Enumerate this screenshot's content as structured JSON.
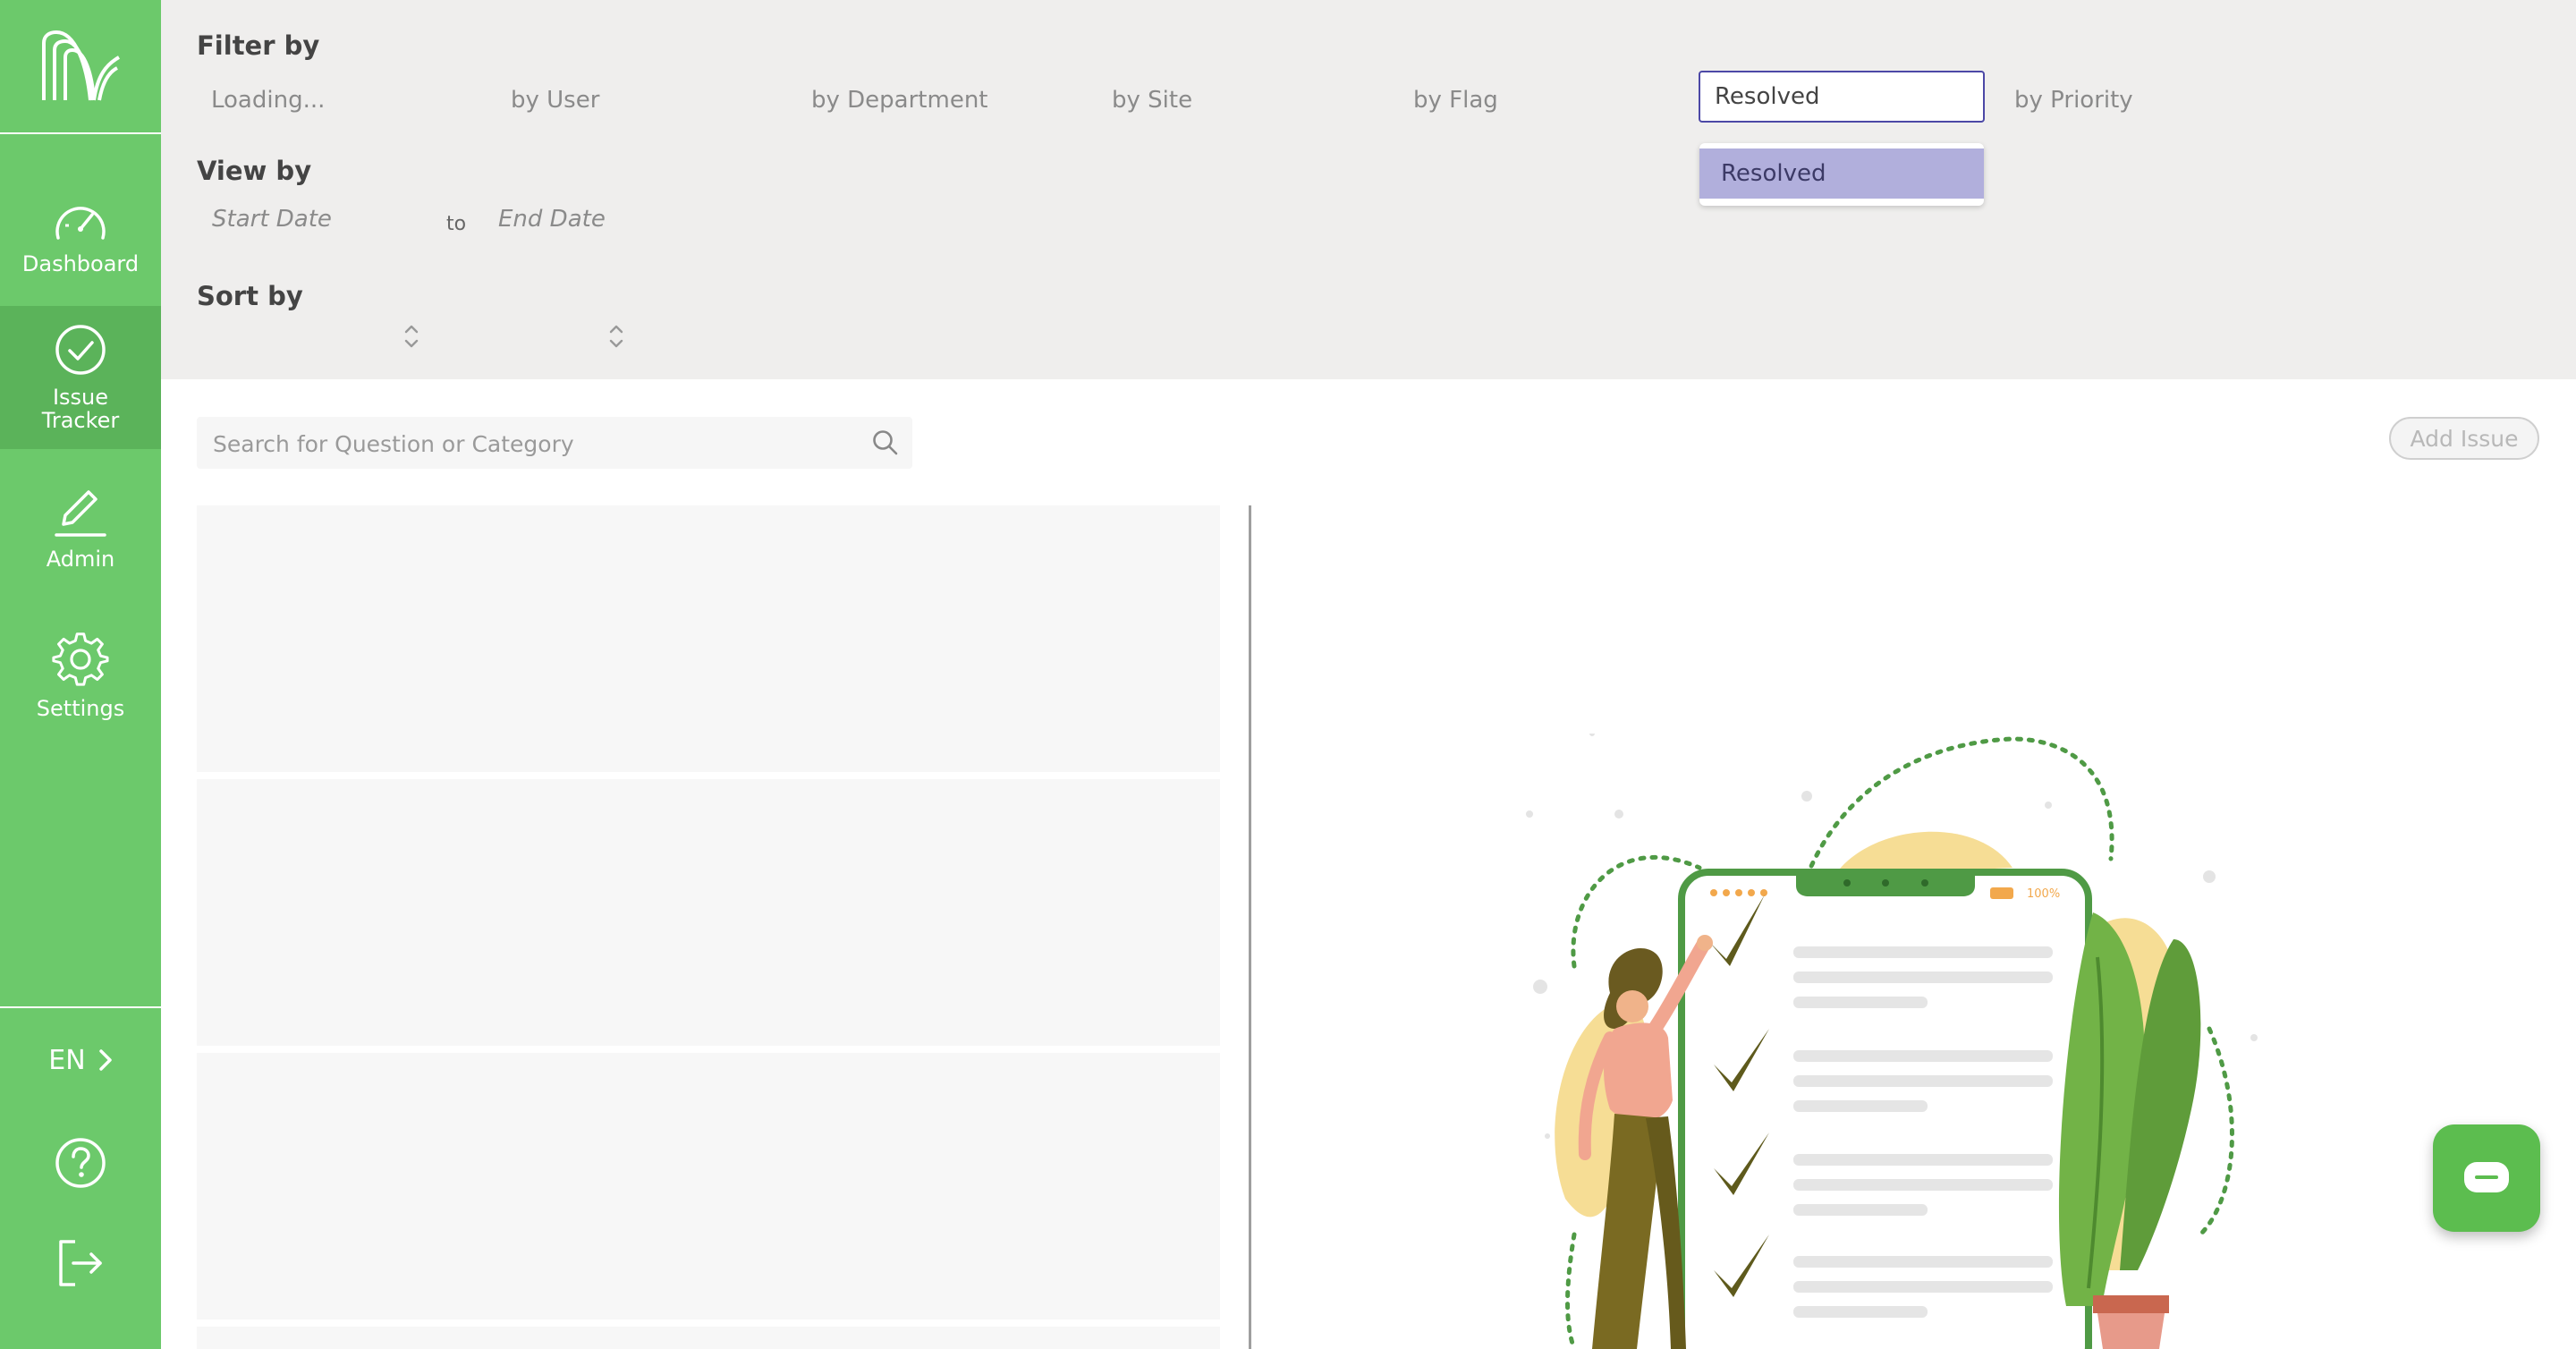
{
  "sidebar": {
    "items": [
      {
        "label": "Dashboard",
        "icon": "speedometer-icon"
      },
      {
        "label": "Issue Tracker",
        "icon": "check-circle-icon",
        "active": true
      },
      {
        "label": "Admin",
        "icon": "pencil-icon"
      },
      {
        "label": "Settings",
        "icon": "gear-icon"
      }
    ],
    "language": "EN"
  },
  "filters": {
    "title": "Filter by",
    "loading": "Loading...",
    "user": "by User",
    "department": "by Department",
    "site": "by Site",
    "flag": "by Flag",
    "status_value": "Resolved",
    "priority": "by Priority",
    "dropdown_options": [
      "Resolved"
    ]
  },
  "view": {
    "title": "View by",
    "start_placeholder": "Start Date",
    "separator": "to",
    "end_placeholder": "End Date"
  },
  "sort": {
    "title": "Sort by"
  },
  "main": {
    "search_placeholder": "Search for Question or Category",
    "add_issue_label": "Add Issue"
  },
  "illustration": {
    "battery_label": "100%"
  },
  "colors": {
    "brand_green": "#6cc96b",
    "active_nav": "#5bb35a",
    "select_border": "#4c48a6",
    "option_highlight": "#b1afdc",
    "chat_button": "#5cbd4f"
  }
}
